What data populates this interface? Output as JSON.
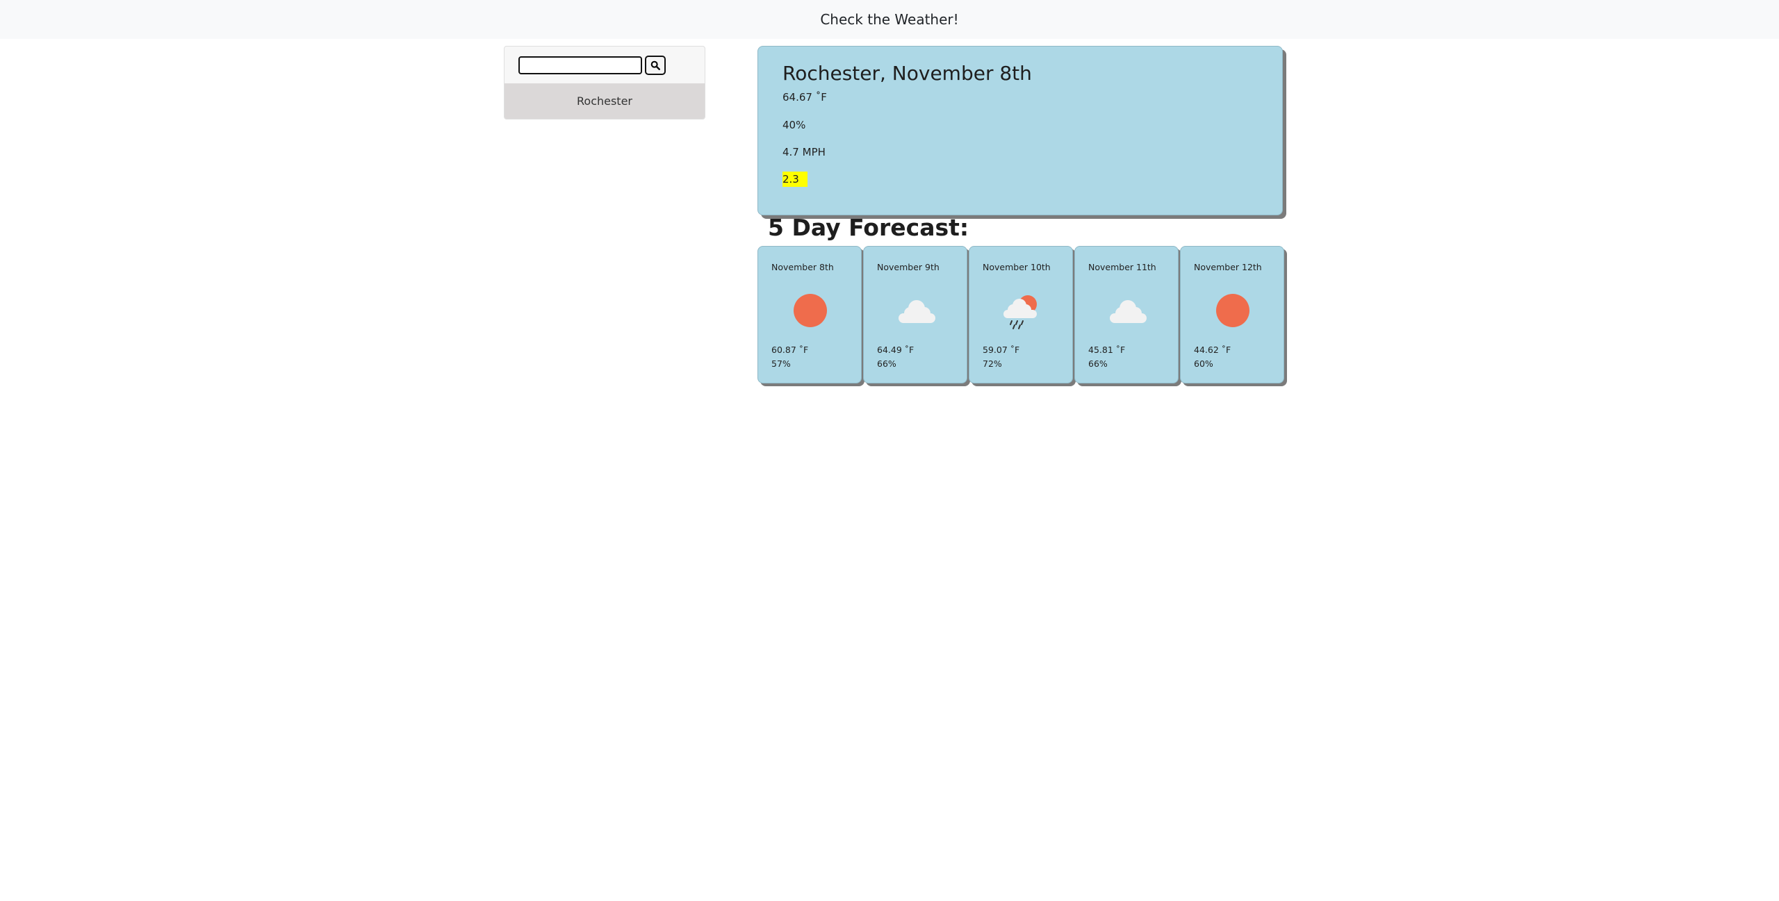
{
  "header": {
    "title": "Check the Weather!"
  },
  "search": {
    "input_value": "",
    "placeholder": ""
  },
  "history": [
    {
      "label": "Rochester"
    }
  ],
  "current": {
    "title": "Rochester, November 8th",
    "temperature": "64.67 ˚F",
    "humidity": "40%",
    "wind": "4.7 MPH",
    "uv_index": "2.3",
    "uv_color": "#ffff00"
  },
  "forecast": {
    "heading": "5 Day Forecast:",
    "days": [
      {
        "date": "November 8th",
        "icon": "sun-icon",
        "temp": "60.87 ˚F",
        "humidity": "57%"
      },
      {
        "date": "November 9th",
        "icon": "cloud-icon",
        "temp": "64.49 ˚F",
        "humidity": "66%"
      },
      {
        "date": "November 10th",
        "icon": "rain-sun-icon",
        "temp": "59.07 ˚F",
        "humidity": "72%"
      },
      {
        "date": "November 11th",
        "icon": "cloud-icon",
        "temp": "45.81 ˚F",
        "humidity": "66%"
      },
      {
        "date": "November 12th",
        "icon": "sun-icon",
        "temp": "44.62 ˚F",
        "humidity": "60%"
      }
    ]
  },
  "colors": {
    "card_background": "#add8e6",
    "sun": "#ef6c4c",
    "cloud": "#f2f2f2",
    "uv_highlight": "#ffff00"
  }
}
